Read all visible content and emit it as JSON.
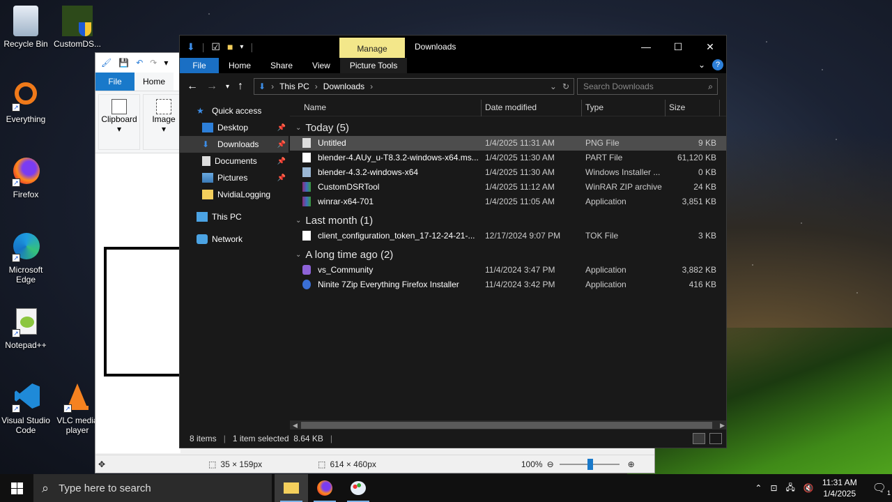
{
  "desktop": {
    "icons": [
      {
        "label": "Recycle Bin"
      },
      {
        "label": "CustomDS..."
      },
      {
        "label": "Everything"
      },
      {
        "label": "Firefox"
      },
      {
        "label": "Microsoft Edge"
      },
      {
        "label": "Notepad++"
      },
      {
        "label": "Visual Studio Code"
      },
      {
        "label": "VLC media player"
      }
    ]
  },
  "paint": {
    "tabs": [
      "File",
      "Home"
    ],
    "groups": [
      "Clipboard",
      "Image"
    ],
    "status": {
      "selection_size": "35 × 159px",
      "image_size": "614 × 460px",
      "zoom": "100%"
    }
  },
  "explorer": {
    "title": "Downloads",
    "context_tab": "Manage",
    "ribbon_tabs": [
      "File",
      "Home",
      "Share",
      "View",
      "Picture Tools"
    ],
    "breadcrumb": [
      "This PC",
      "Downloads"
    ],
    "search_placeholder": "Search Downloads",
    "columns": [
      "Name",
      "Date modified",
      "Type",
      "Size"
    ],
    "nav": {
      "quick_access": "Quick access",
      "items": [
        "Desktop",
        "Downloads",
        "Documents",
        "Pictures",
        "NvidiaLogging"
      ],
      "this_pc": "This PC",
      "network": "Network"
    },
    "groups": [
      {
        "label": "Today (5)",
        "rows": [
          {
            "name": "Untitled",
            "date": "1/4/2025 11:31 AM",
            "type": "PNG File",
            "size": "9 KB"
          },
          {
            "name": "blender-4.AUy_u-T8.3.2-windows-x64.ms...",
            "date": "1/4/2025 11:30 AM",
            "type": "PART File",
            "size": "61,120 KB"
          },
          {
            "name": "blender-4.3.2-windows-x64",
            "date": "1/4/2025 11:30 AM",
            "type": "Windows Installer ...",
            "size": "0 KB"
          },
          {
            "name": "CustomDSRTool",
            "date": "1/4/2025 11:12 AM",
            "type": "WinRAR ZIP archive",
            "size": "24 KB"
          },
          {
            "name": "winrar-x64-701",
            "date": "1/4/2025 11:05 AM",
            "type": "Application",
            "size": "3,851 KB"
          }
        ]
      },
      {
        "label": "Last month (1)",
        "rows": [
          {
            "name": "client_configuration_token_17-12-24-21-...",
            "date": "12/17/2024 9:07 PM",
            "type": "TOK File",
            "size": "3 KB"
          }
        ]
      },
      {
        "label": "A long time ago (2)",
        "rows": [
          {
            "name": "vs_Community",
            "date": "11/4/2024 3:47 PM",
            "type": "Application",
            "size": "3,882 KB"
          },
          {
            "name": "Ninite 7Zip Everything Firefox Installer",
            "date": "11/4/2024 3:42 PM",
            "type": "Application",
            "size": "416 KB"
          }
        ]
      }
    ],
    "status": {
      "item_count": "8 items",
      "selected": "1 item selected  8.64 KB"
    }
  },
  "taskbar": {
    "search_placeholder": "Type here to search",
    "time": "11:31 AM",
    "date": "1/4/2025",
    "notification_count": "1"
  },
  "colors": {
    "accent": "#1a6fc4",
    "manage_tab": "#f3e78a",
    "selection": "#4d4d4d"
  }
}
